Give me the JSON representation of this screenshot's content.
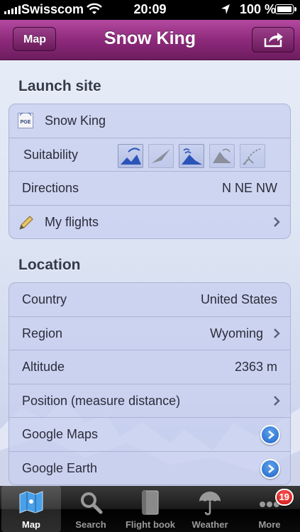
{
  "status_bar": {
    "carrier": "Swisscom",
    "time": "20:09",
    "battery": "100 %"
  },
  "nav": {
    "back_label": "Map",
    "title": "Snow King"
  },
  "launch_site": {
    "header": "Launch site",
    "site_name": "Snow King",
    "suitability_label": "Suitability",
    "directions_label": "Directions",
    "directions_value": "N NE NW",
    "my_flights_label": "My flights"
  },
  "location": {
    "header": "Location",
    "country_label": "Country",
    "country_value": "United States",
    "region_label": "Region",
    "region_value": "Wyoming",
    "altitude_label": "Altitude",
    "altitude_value": "2363 m",
    "position_label": "Position (measure distance)",
    "google_maps_label": "Google Maps",
    "google_earth_label": "Google Earth"
  },
  "tabs": [
    {
      "label": "Map",
      "icon": "map-icon"
    },
    {
      "label": "Search",
      "icon": "search-icon"
    },
    {
      "label": "Flight book",
      "icon": "book-icon"
    },
    {
      "label": "Weather",
      "icon": "umbrella-icon"
    },
    {
      "label": "More",
      "icon": "more-icon",
      "badge": "19"
    }
  ],
  "colors": {
    "navbar": "#8e2a7c",
    "disclosure": "#1f64c8",
    "badge": "#c80c0c"
  }
}
